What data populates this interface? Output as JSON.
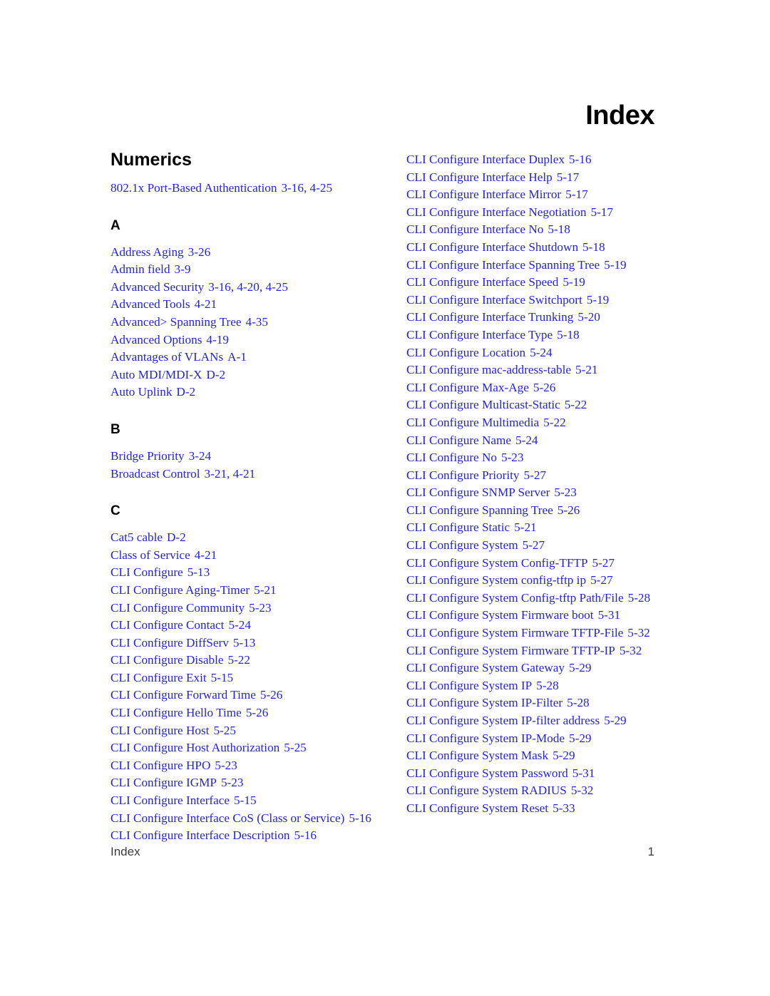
{
  "document": {
    "title": "Index",
    "footer_label": "Index",
    "page_number": "1",
    "entry_color": "#2222e0",
    "heading_color": "#000000"
  },
  "columns": [
    {
      "name": "left-column",
      "sections": [
        {
          "heading": "Numerics",
          "heading_style": "big",
          "entries": [
            {
              "term": "802.1x Port-Based Authentication",
              "locators": "3-16, 4-25"
            }
          ]
        },
        {
          "heading": "A",
          "heading_style": "letter",
          "entries": [
            {
              "term": "Address Aging",
              "locators": "3-26"
            },
            {
              "term": "Admin field",
              "locators": "3-9"
            },
            {
              "term": "Advanced Security",
              "locators": "3-16, 4-20, 4-25"
            },
            {
              "term": "Advanced Tools",
              "locators": "4-21"
            },
            {
              "term": "Advanced> Spanning Tree",
              "locators": "4-35"
            },
            {
              "term": "Advanced Options",
              "locators": "4-19"
            },
            {
              "term": "Advantages of VLANs",
              "locators": "A-1"
            },
            {
              "term": "Auto MDI/MDI-X",
              "locators": "D-2"
            },
            {
              "term": "Auto Uplink",
              "locators": "D-2"
            }
          ]
        },
        {
          "heading": "B",
          "heading_style": "letter",
          "entries": [
            {
              "term": "Bridge Priority",
              "locators": "3-24"
            },
            {
              "term": "Broadcast Control",
              "locators": "3-21, 4-21"
            }
          ]
        },
        {
          "heading": "C",
          "heading_style": "letter",
          "entries": [
            {
              "term": "Cat5 cable",
              "locators": "D-2"
            },
            {
              "term": "Class of Service",
              "locators": "4-21"
            },
            {
              "term": "CLI Configure",
              "locators": "5-13"
            },
            {
              "term": "CLI Configure Aging-Timer",
              "locators": "5-21"
            },
            {
              "term": "CLI Configure Community",
              "locators": "5-23"
            },
            {
              "term": "CLI Configure Contact",
              "locators": "5-24"
            },
            {
              "term": "CLI Configure DiffServ",
              "locators": "5-13"
            },
            {
              "term": "CLI Configure Disable",
              "locators": "5-22"
            },
            {
              "term": "CLI Configure Exit",
              "locators": "5-15"
            },
            {
              "term": "CLI Configure Forward Time",
              "locators": "5-26"
            },
            {
              "term": "CLI Configure Hello Time",
              "locators": "5-26"
            },
            {
              "term": "CLI Configure Host",
              "locators": "5-25"
            },
            {
              "term": "CLI Configure Host Authorization",
              "locators": "5-25"
            },
            {
              "term": "CLI Configure HPO",
              "locators": "5-23"
            },
            {
              "term": "CLI Configure IGMP",
              "locators": "5-23"
            },
            {
              "term": "CLI Configure Interface",
              "locators": "5-15"
            },
            {
              "term": "CLI Configure Interface CoS (Class or Service)",
              "locators": "5-16"
            },
            {
              "term": "CLI Configure Interface Description",
              "locators": "5-16"
            }
          ]
        }
      ]
    },
    {
      "name": "right-column",
      "sections": [
        {
          "heading": "",
          "heading_style": "none",
          "entries": [
            {
              "term": "CLI Configure Interface Duplex",
              "locators": "5-16"
            },
            {
              "term": "CLI Configure Interface Help",
              "locators": "5-17"
            },
            {
              "term": "CLI Configure Interface Mirror",
              "locators": "5-17"
            },
            {
              "term": "CLI Configure Interface Negotiation",
              "locators": "5-17"
            },
            {
              "term": "CLI Configure Interface No",
              "locators": "5-18"
            },
            {
              "term": "CLI Configure Interface Shutdown",
              "locators": "5-18"
            },
            {
              "term": "CLI Configure Interface Spanning Tree",
              "locators": "5-19"
            },
            {
              "term": "CLI Configure Interface Speed",
              "locators": "5-19"
            },
            {
              "term": "CLI Configure Interface Switchport",
              "locators": "5-19"
            },
            {
              "term": "CLI Configure Interface Trunking",
              "locators": "5-20"
            },
            {
              "term": "CLI Configure Interface Type",
              "locators": "5-18"
            },
            {
              "term": "CLI Configure Location",
              "locators": "5-24"
            },
            {
              "term": "CLI Configure mac-address-table",
              "locators": "5-21"
            },
            {
              "term": "CLI Configure Max-Age",
              "locators": "5-26"
            },
            {
              "term": "CLI Configure Multicast-Static",
              "locators": "5-22"
            },
            {
              "term": "CLI Configure Multimedia",
              "locators": "5-22"
            },
            {
              "term": "CLI Configure Name",
              "locators": "5-24"
            },
            {
              "term": "CLI Configure No",
              "locators": "5-23"
            },
            {
              "term": "CLI Configure Priority",
              "locators": "5-27"
            },
            {
              "term": "CLI Configure SNMP Server",
              "locators": "5-23"
            },
            {
              "term": "CLI Configure Spanning Tree",
              "locators": "5-26"
            },
            {
              "term": "CLI Configure Static",
              "locators": "5-21"
            },
            {
              "term": "CLI Configure System",
              "locators": "5-27"
            },
            {
              "term": "CLI Configure System Config-TFTP",
              "locators": "5-27"
            },
            {
              "term": "CLI Configure System config-tftp ip",
              "locators": "5-27"
            },
            {
              "term": "CLI Configure System Config-tftp Path/File",
              "locators": "5-28"
            },
            {
              "term": "CLI Configure System Firmware boot",
              "locators": "5-31"
            },
            {
              "term": "CLI Configure System Firmware TFTP-File",
              "locators": "5-32"
            },
            {
              "term": "CLI Configure System Firmware TFTP-IP",
              "locators": "5-32"
            },
            {
              "term": "CLI Configure System Gateway",
              "locators": "5-29"
            },
            {
              "term": "CLI Configure System IP",
              "locators": "5-28"
            },
            {
              "term": "CLI Configure System IP-Filter",
              "locators": "5-28"
            },
            {
              "term": "CLI Configure System IP-filter address",
              "locators": "5-29"
            },
            {
              "term": "CLI Configure System IP-Mode",
              "locators": "5-29"
            },
            {
              "term": "CLI Configure System Mask",
              "locators": "5-29"
            },
            {
              "term": "CLI Configure System Password",
              "locators": "5-31"
            },
            {
              "term": "CLI Configure System RADIUS",
              "locators": "5-32"
            },
            {
              "term": "CLI Configure System Reset",
              "locators": "5-33"
            }
          ]
        }
      ]
    }
  ]
}
